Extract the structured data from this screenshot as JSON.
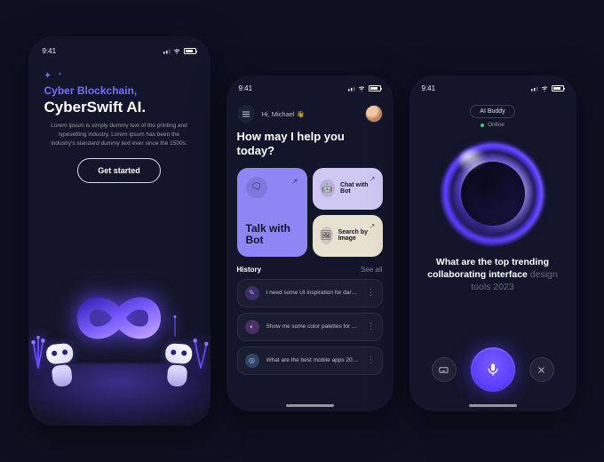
{
  "status_time": "9:41",
  "screen1": {
    "tagline": "Cyber Blockchain,",
    "title": "CyberSwift AI.",
    "description": "Lorem ipsum is simply dummy text of the printing and typesetting industry. Lorem ipsum has been the industry's standard dummy text ever since the 1500s.",
    "cta": "Get started"
  },
  "screen2": {
    "greeting": "Hi, Michael 👋",
    "prompt": "How may I help you today?",
    "card_large": "Talk with Bot",
    "card_small_1": "Chat with Bot",
    "card_small_2": "Search by Image",
    "history_label": "History",
    "see_all": "See all",
    "history": [
      "I need some UI inspiration for dark…",
      "Show me some color palettes for AI…",
      "What are the best mobile apps 2023…"
    ]
  },
  "screen3": {
    "chip": "AI Buddy",
    "status": "Online",
    "question_main": "What are the top trending collaborating interface",
    "question_fade": " design tools 2023"
  }
}
